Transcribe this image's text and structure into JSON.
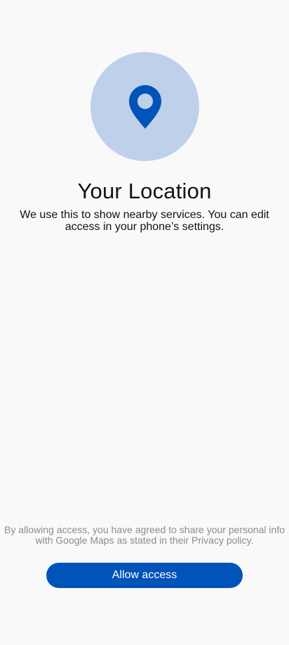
{
  "hero": {
    "icon": "location-pin-icon",
    "circle_color": "#bed0ea",
    "icon_color": "#0053b9"
  },
  "title": "Your Location",
  "subtitle": "We use this to show nearby services. You can edit access in your phone’s settings.",
  "disclaimer": "By allowing access, you have agreed to share your personal info with Google Maps as stated in their Privacy policy.",
  "allow_button": {
    "label": "Allow access",
    "color": "#0053b9"
  }
}
